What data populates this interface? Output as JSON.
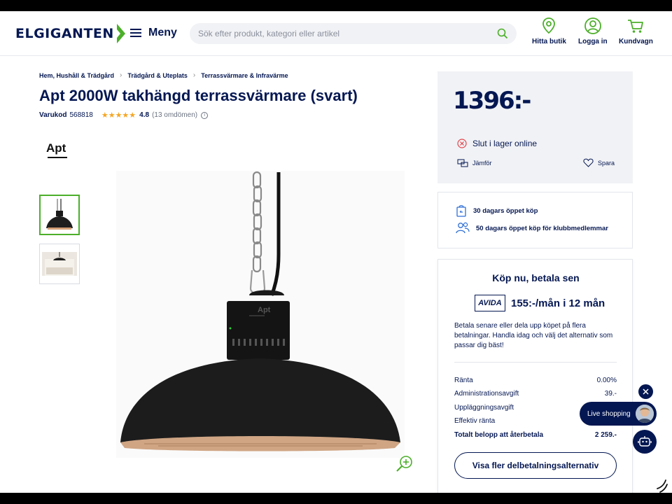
{
  "header": {
    "logo_text": "ELGIGANTEN",
    "menu_label": "Meny",
    "search_placeholder": "Sök efter produkt, kategori eller artikel",
    "actions": [
      {
        "label": "Hitta butik",
        "icon": "location-pin-icon"
      },
      {
        "label": "Logga in",
        "icon": "user-icon"
      },
      {
        "label": "Kundvagn",
        "icon": "cart-icon"
      }
    ]
  },
  "breadcrumb": [
    "Hem, Hushåll & Trädgård",
    "Trädgård & Uteplats",
    "Terrassvärmare & Infravärme"
  ],
  "product": {
    "title": "Apt 2000W takhängd terrassvärmare (svart)",
    "sku_label": "Varukod",
    "sku": "568818",
    "stars": "★★★★★",
    "rating": "4.8",
    "reviews": "(13 omdömen)",
    "brand": "Apt",
    "lamp_brand": "Apt"
  },
  "price_box": {
    "price": "1396:-",
    "stock_status": "Slut i lager online",
    "compare_label": "Jämför",
    "save_label": "Spara"
  },
  "perks": [
    "30 dagars öppet köp",
    "50 dagars öppet köp för klubbmedlemmar"
  ],
  "financing": {
    "title": "Köp nu, betala sen",
    "provider": "AVIDA",
    "monthly": "155:-/mån i 12 mån",
    "description": "Betala senare eller dela upp köpet på flera betalningar. Handla idag och välj det alternativ som passar dig bäst!",
    "lines": [
      {
        "label": "Ränta",
        "value": "0.00%"
      },
      {
        "label": "Administrationsavgift",
        "value": "39.-"
      },
      {
        "label": "Uppläggningsavgift",
        "value": ""
      },
      {
        "label": "Effektiv ränta",
        "value": ""
      },
      {
        "label": "Totalt belopp att återbetala",
        "value": "2 259.-"
      }
    ],
    "more_button": "Visa fler delbetalningsalternativ"
  },
  "live": {
    "label": "Live shopping"
  },
  "colors": {
    "navy": "#041752",
    "green": "#4caf2a",
    "star": "#f5a623",
    "panel_bg": "#f1f2f5"
  }
}
